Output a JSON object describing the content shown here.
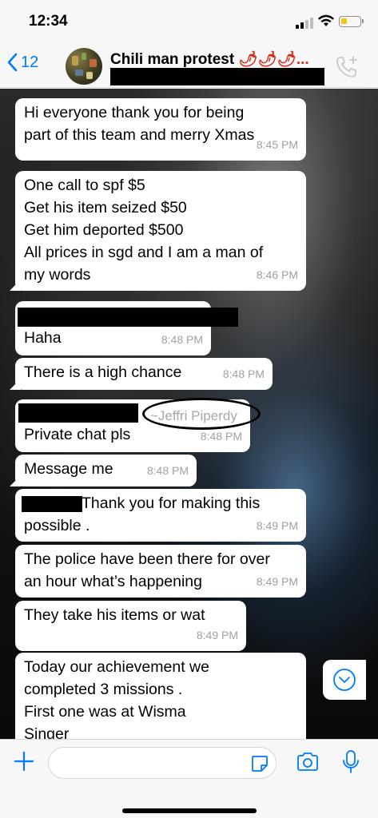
{
  "status": {
    "time": "12:34"
  },
  "header": {
    "back_count": "12",
    "title": "Chili man protest",
    "title_emoji": "🌶🌶🌶...",
    "accent": "#007aff"
  },
  "messages": [
    {
      "text": "Hi everyone thank you for being\npart of this team and merry Xmas",
      "time": "8:45 PM"
    },
    {
      "text": "One call to spf $5\nGet his item seized $50\nGet him deported $500\nAll prices in sgd and I am a man of\nmy words",
      "time": "8:46 PM"
    },
    {
      "text": "Haha",
      "time": "8:48 PM"
    },
    {
      "text": "There is a high chance",
      "time": "8:48 PM"
    },
    {
      "sender": "~Jeffri Piperdy",
      "text": "Private chat pls",
      "time": "8:48 PM"
    },
    {
      "text": "Message me",
      "time": "8:48 PM"
    },
    {
      "text": "Thank you for making this\npossible .",
      "time": "8:49 PM"
    },
    {
      "text": "The police have been there for over\nan hour what’s happening",
      "time": "8:49 PM"
    },
    {
      "text": "They take his items or wat",
      "time": "8:49 PM"
    },
    {
      "text": "Today our achievement we\ncompleted 3 missions .\nFirst one was at Wisma\nSinger"
    }
  ],
  "icons": {
    "back": "chevron-left-icon",
    "call": "phone-plus-icon",
    "scroll": "chevron-down-circle-icon",
    "attach": "plus-icon",
    "sticker": "sticker-icon",
    "camera": "camera-icon",
    "mic": "microphone-icon"
  }
}
